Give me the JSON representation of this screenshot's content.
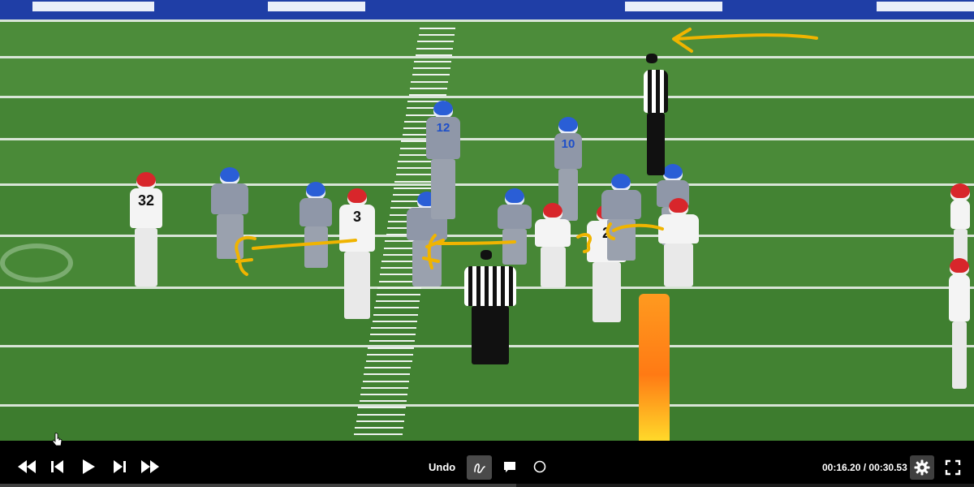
{
  "video": {
    "scene": "football-broadcast-frame",
    "jersey_numbers": [
      "32",
      "3",
      "12",
      "10",
      "2"
    ],
    "pylon_color": "#ff8a1a",
    "annotation_color": "#f0b400"
  },
  "controls": {
    "rewind_icon": "rewind-icon",
    "step_back_icon": "step-back-icon",
    "play_icon": "play-icon",
    "step_forward_icon": "step-forward-icon",
    "fast_forward_icon": "fast-forward-icon",
    "undo_label": "Undo",
    "draw_tool_icon": "pen-squiggle-icon",
    "comment_tool_icon": "comment-icon",
    "circle_tool_icon": "circle-icon",
    "current_time": "00:16.20",
    "separator": " / ",
    "total_time": "00:30.53",
    "settings_icon": "gear-icon",
    "fullscreen_icon": "fullscreen-icon",
    "progress_fraction": 0.53
  },
  "colors": {
    "bar_bg": "#000000",
    "active_tool_bg": "#4a4a4a",
    "kentucky_blue": "#2a5ed6",
    "georgia_red": "#d8262b"
  }
}
